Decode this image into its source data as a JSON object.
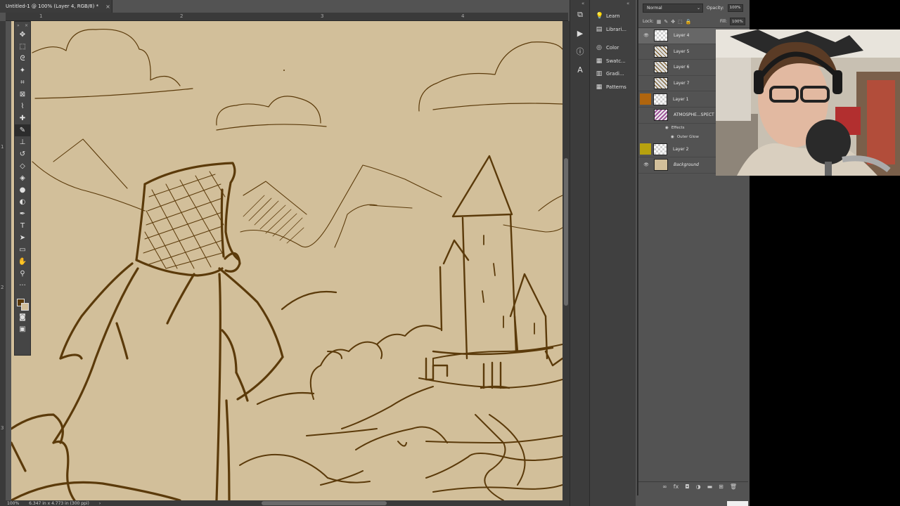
{
  "document": {
    "tab_title": "Untitled-1 @ 100% (Layer 4, RGB/8) *",
    "close_glyph": "×",
    "ruler_numbers": [
      "1",
      "2",
      "3",
      "4"
    ],
    "left_ruler_numbers": [
      "1",
      "2",
      "3"
    ]
  },
  "status_bar": {
    "zoom": "100%",
    "doc_info": "6.347 in x 4.773 in (300 ppi)",
    "arrow": "›"
  },
  "toolbar": {
    "tools": [
      {
        "name": "move-tool",
        "glyph": "✥"
      },
      {
        "name": "marquee-tool",
        "glyph": "⬚"
      },
      {
        "name": "lasso-tool",
        "glyph": "ᘓ"
      },
      {
        "name": "magic-wand-tool",
        "glyph": "✦"
      },
      {
        "name": "crop-tool",
        "glyph": "⌗"
      },
      {
        "name": "frame-tool",
        "glyph": "⊠"
      },
      {
        "name": "eyedropper-tool",
        "glyph": "⌇"
      },
      {
        "name": "healing-brush-tool",
        "glyph": "✚"
      },
      {
        "name": "brush-tool",
        "glyph": "✎"
      },
      {
        "name": "clone-stamp-tool",
        "glyph": "⊥"
      },
      {
        "name": "history-brush-tool",
        "glyph": "↺"
      },
      {
        "name": "eraser-tool",
        "glyph": "◇"
      },
      {
        "name": "paint-bucket-tool",
        "glyph": "◈"
      },
      {
        "name": "blur-tool",
        "glyph": "●"
      },
      {
        "name": "dodge-tool",
        "glyph": "◐"
      },
      {
        "name": "pen-tool",
        "glyph": "✒"
      },
      {
        "name": "type-tool",
        "glyph": "T"
      },
      {
        "name": "path-selection-tool",
        "glyph": "➤"
      },
      {
        "name": "rectangle-tool",
        "glyph": "▭"
      },
      {
        "name": "hand-tool",
        "glyph": "✋"
      },
      {
        "name": "zoom-tool",
        "glyph": "⚲"
      },
      {
        "name": "edit-toolbar",
        "glyph": "···"
      }
    ],
    "foreground_color": "#5b3a0a",
    "background_color": "#d2bf9a",
    "bottom_tools": [
      {
        "name": "quick-mask-tool",
        "glyph": "◙"
      },
      {
        "name": "screen-mode-tool",
        "glyph": "▣"
      }
    ]
  },
  "dock": {
    "strip_icons": [
      {
        "name": "history-icon",
        "glyph": "⧉"
      },
      {
        "name": "actions-icon",
        "glyph": "▶"
      },
      {
        "name": "info-icon",
        "glyph": "ⓘ"
      },
      {
        "name": "character-icon",
        "glyph": "A"
      }
    ],
    "panels": [
      {
        "icon": "learn-icon",
        "glyph": "💡",
        "label": "Learn"
      },
      {
        "icon": "libraries-icon",
        "glyph": "▤",
        "label": "Librari..."
      },
      {
        "icon": "color-icon",
        "glyph": "◎",
        "label": "Color"
      },
      {
        "icon": "swatches-icon",
        "glyph": "▦",
        "label": "Swatc..."
      },
      {
        "icon": "gradients-icon",
        "glyph": "▥",
        "label": "Gradi..."
      },
      {
        "icon": "patterns-icon",
        "glyph": "▦",
        "label": "Patterns"
      }
    ],
    "collapse_glyph": "«"
  },
  "layers_panel": {
    "blend_mode": "Normal",
    "opacity_label": "Opacity:",
    "opacity_value": "100%",
    "lock_label": "Lock:",
    "fill_label": "Fill:",
    "fill_value": "100%",
    "layers": [
      {
        "name": "Layer 4",
        "visible": true,
        "selected": true,
        "thumb": "check"
      },
      {
        "name": "Layer 5",
        "visible": false,
        "selected": false,
        "thumb": "art"
      },
      {
        "name": "Layer 6",
        "visible": false,
        "selected": false,
        "thumb": "art"
      },
      {
        "name": "Layer 7",
        "visible": false,
        "selected": false,
        "thumb": "art"
      },
      {
        "name": "Layer 1",
        "visible": false,
        "selected": false,
        "thumb": "check",
        "swatch": "#b0650e"
      },
      {
        "name": "ATMOSPHE...SPECT",
        "visible": false,
        "selected": false,
        "thumb": "purple"
      },
      {
        "name": "Layer 2",
        "visible": false,
        "selected": false,
        "thumb": "check",
        "swatch": "#b7a20e"
      },
      {
        "name": "Background",
        "visible": true,
        "selected": false,
        "thumb": "tan",
        "italic": true
      }
    ],
    "effects_label": "Effects",
    "outer_glow_label": "Outer Glow",
    "bottom_icons": [
      {
        "name": "link-layers-icon",
        "glyph": "∞"
      },
      {
        "name": "fx-icon",
        "glyph": "fx"
      },
      {
        "name": "add-mask-icon",
        "glyph": "◘"
      },
      {
        "name": "adjustment-layer-icon",
        "glyph": "◑"
      },
      {
        "name": "new-group-icon",
        "glyph": "▬"
      },
      {
        "name": "new-layer-icon",
        "glyph": "⊞"
      },
      {
        "name": "delete-layer-icon",
        "glyph": "🗑"
      }
    ]
  }
}
